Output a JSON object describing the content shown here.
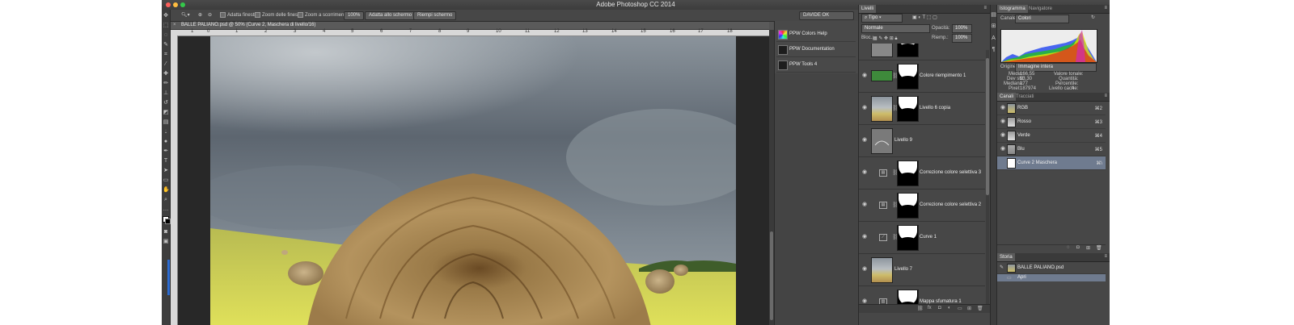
{
  "window": {
    "title": "Adobe Photoshop CC 2014"
  },
  "options_bar": {
    "fit_window": "Adatta finestre",
    "zoom_all": "Zoom delle finestre",
    "scrubby_zoom": "Zoom a scorrimento",
    "zoom_value": "100%",
    "fit_screen": "Adatta allo schermo",
    "fill_screen": "Riempi schermo",
    "workspace": "DAVIDE OK"
  },
  "document": {
    "tab_title": "BALLE PALIANO.psd @ 50% (Curve 2, Maschera di livello/16)",
    "ruler_numbers": [
      "1",
      "0",
      "1",
      "2",
      "3",
      "4",
      "5",
      "6",
      "7",
      "8",
      "9",
      "10",
      "11",
      "12",
      "13",
      "14",
      "15",
      "16",
      "17",
      "18"
    ]
  },
  "ppw_panel": {
    "items": [
      {
        "label": "PPW Colors Help"
      },
      {
        "label": "PPW Documentation"
      },
      {
        "label": "PPW Tools 4"
      }
    ]
  },
  "layers_panel": {
    "tab": "Livelli",
    "filter": "Tipo",
    "blend_mode": "Normale",
    "opacity_label": "Opacità:",
    "opacity_value": "100%",
    "lock_label": "Bloc.:",
    "fill_label": "Riemp.:",
    "fill_value": "100%",
    "layers": [
      {
        "name": ""
      },
      {
        "name": "Colore riempimento 1"
      },
      {
        "name": "Livello 6 copia"
      },
      {
        "name": "Livello 9"
      },
      {
        "name": "Correzione colore selettiva 3"
      },
      {
        "name": "Correzione colore selettiva 2"
      },
      {
        "name": "Curve 1"
      },
      {
        "name": "Livello 7"
      },
      {
        "name": "Mappa sfumatura 1"
      }
    ],
    "fill_color": "#3e8a3b"
  },
  "histogram_panel": {
    "tabs": [
      "Istogramma",
      "Navigatore"
    ],
    "channel_label": "Canale:",
    "channel_value": "Colori",
    "source_label": "Origine:",
    "source_value": "Immagine intera",
    "stats": {
      "media_label": "Media:",
      "media": "166,55",
      "devstd_label": "Dev std:",
      "devstd": "53,30",
      "mediana_label": "Mediana:",
      "mediana": "177",
      "pixel_label": "Pixel:",
      "pixel": "187974",
      "valori_label": "Valore tonale:",
      "quantita_label": "Quantità:",
      "percentile_label": "Percentile:",
      "livello_cache_label": "Livello cache:",
      "livello_cache": "4"
    }
  },
  "channels_panel": {
    "tabs": [
      "Canali",
      "Tracciati"
    ],
    "channels": [
      {
        "name": "RGB",
        "shortcut": "⌘2"
      },
      {
        "name": "Rosso",
        "shortcut": "⌘3"
      },
      {
        "name": "Verde",
        "shortcut": "⌘4"
      },
      {
        "name": "Blu",
        "shortcut": "⌘5"
      },
      {
        "name": "Curve 2 Maschera",
        "shortcut": "⌘\\"
      }
    ]
  },
  "history_panel": {
    "tab": "Storia",
    "snapshot": "BALLE PALIANO.psd",
    "steps": [
      {
        "name": "Apri"
      }
    ]
  }
}
